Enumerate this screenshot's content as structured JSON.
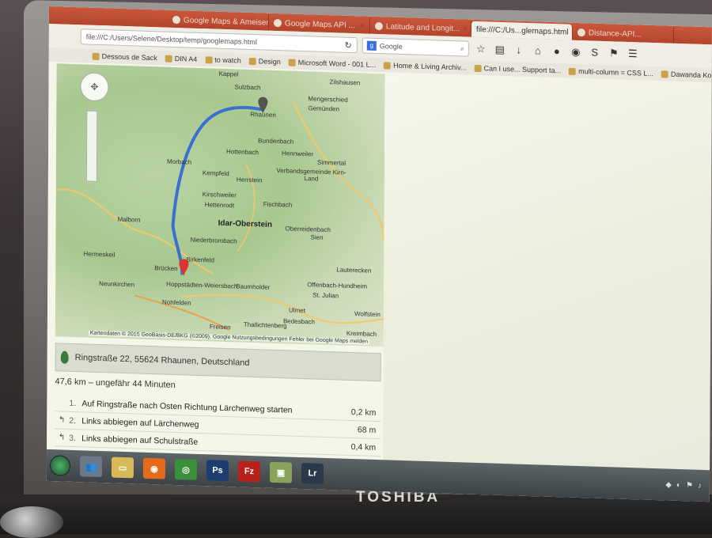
{
  "browser": {
    "tabs": [
      {
        "label": "Google Maps & Ameisen...",
        "active": false
      },
      {
        "label": "Google Maps API ...",
        "active": false
      },
      {
        "label": "Latitude and Longit...",
        "active": false
      },
      {
        "label": "file:///C:/Us...glemaps.html",
        "active": true
      },
      {
        "label": "Distance-API...",
        "active": false
      }
    ],
    "url": "file:///C:/Users/Selene/Desktop/temp/googlemaps.html",
    "search_engine": "Google",
    "search_placeholder": "Google"
  },
  "bookmarks": [
    {
      "label": "Dessous de Sack"
    },
    {
      "label": "DIN A4"
    },
    {
      "label": "to watch"
    },
    {
      "label": "Design"
    },
    {
      "label": "Microsoft Word - 001 L..."
    },
    {
      "label": "Home & Living Archiv..."
    },
    {
      "label": "Can I use... Support ta..."
    },
    {
      "label": "multi-column = CSS L..."
    },
    {
      "label": "Dawanda Kooperation"
    }
  ],
  "map": {
    "places": [
      {
        "name": "Rhaunen",
        "major": false
      },
      {
        "name": "Sulzbach",
        "major": false
      },
      {
        "name": "Bundenbach",
        "major": false
      },
      {
        "name": "Hottenbach",
        "major": false
      },
      {
        "name": "Hennweiler",
        "major": false
      },
      {
        "name": "Simmertal",
        "major": false
      },
      {
        "name": "Morbach",
        "major": false
      },
      {
        "name": "Kempfeld",
        "major": false
      },
      {
        "name": "Herrstein",
        "major": false
      },
      {
        "name": "Verbandsgemeinde Kirn-Land",
        "major": false
      },
      {
        "name": "Kirschweiler",
        "major": false
      },
      {
        "name": "Hettenrodt",
        "major": false
      },
      {
        "name": "Fischbach",
        "major": false
      },
      {
        "name": "Idar-Oberstein",
        "major": true
      },
      {
        "name": "Oberreidenbach",
        "major": false
      },
      {
        "name": "Sien",
        "major": false
      },
      {
        "name": "Niederbrombach",
        "major": false
      },
      {
        "name": "Birkenfeld",
        "major": false
      },
      {
        "name": "Brücken",
        "major": false
      },
      {
        "name": "Hoppstädten-Weiersbach",
        "major": false
      },
      {
        "name": "Baumholder",
        "major": false
      },
      {
        "name": "Offenbach-Hundheim",
        "major": false
      },
      {
        "name": "St. Julian",
        "major": false
      },
      {
        "name": "Nohfelden",
        "major": false
      },
      {
        "name": "Ulmet",
        "major": false
      },
      {
        "name": "Bedesbach",
        "major": false
      },
      {
        "name": "Lauterecken",
        "major": false
      },
      {
        "name": "Thallichtenberg",
        "major": false
      },
      {
        "name": "Freisen",
        "major": false
      },
      {
        "name": "Kreimbach",
        "major": false
      },
      {
        "name": "Wolfstein",
        "major": false
      },
      {
        "name": "Mengerschied",
        "major": false
      },
      {
        "name": "Gemünden",
        "major": false
      },
      {
        "name": "Kappel",
        "major": false
      },
      {
        "name": "Zilshausen",
        "major": false
      },
      {
        "name": "Malborn",
        "major": false
      },
      {
        "name": "Hermeskeil",
        "major": false
      },
      {
        "name": "Neunkirchen",
        "major": false
      }
    ],
    "attribution": "Kartendaten © 2015 GeoBasis-DE/BKG (©2009), Google   Nutzungsbedingungen   Fehler bei Google Maps melden",
    "route_color": "#3b6fd0"
  },
  "directions": {
    "destination": "Ringstraße 22, 55624 Rhaunen, Deutschland",
    "summary": "47,6 km – ungefähr 44 Minuten",
    "steps": [
      {
        "num": "1.",
        "text": "Auf Ringstraße nach Osten Richtung Lärchenweg starten",
        "dist": "0,2 km",
        "icon": "straight-icon"
      },
      {
        "num": "2.",
        "text": "Links abbiegen auf Lärchenweg",
        "dist": "68 m",
        "icon": "turn-left-icon"
      },
      {
        "num": "3.",
        "text": "Links abbiegen auf Schulstraße",
        "dist": "0,4 km",
        "icon": "turn-left-icon"
      }
    ]
  },
  "taskbar": {
    "apps": [
      {
        "name": "file-explorer"
      },
      {
        "name": "firefox"
      },
      {
        "name": "chrome"
      },
      {
        "name": "photoshop",
        "label": "Ps"
      },
      {
        "name": "filezilla",
        "label": "Fz"
      },
      {
        "name": "image-viewer"
      },
      {
        "name": "lightroom",
        "label": "Lr"
      }
    ]
  },
  "device": {
    "brand": "TOSHIBA"
  }
}
